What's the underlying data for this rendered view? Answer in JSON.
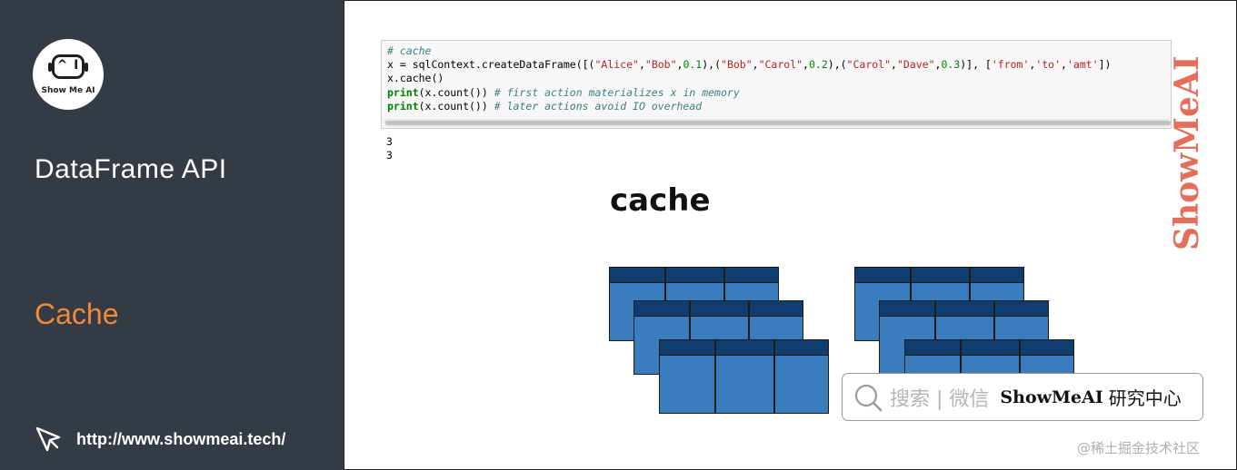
{
  "sidebar": {
    "logo_text": "Show Me AI",
    "logo_glyph": "^ I",
    "title": "DataFrame API",
    "section": "Cache",
    "link": "http://www.showmeai.tech/"
  },
  "code_cell": {
    "line1": "# cache",
    "line2": {
      "pre": "x = sqlContext.createDataFrame([(",
      "s1": "\"Alice\"",
      "c1": ",",
      "s2": "\"Bob\"",
      "c2": ",",
      "n1": "0.1",
      "c3": "),(",
      "s3": "\"Bob\"",
      "c4": ",",
      "s4": "\"Carol\"",
      "c5": ",",
      "n2": "0.2",
      "c6": "),(",
      "s5": "\"Carol\"",
      "c7": ",",
      "s6": "\"Dave\"",
      "c8": ",",
      "n3": "0.3",
      "c9": ")], [",
      "s7": "'from'",
      "c10": ",",
      "s8": "'to'",
      "c11": ",",
      "s9": "'amt'",
      "c12": "])"
    },
    "line3": "x.cache()",
    "line4": {
      "kw": "print",
      "code": "(x.count()) ",
      "comment": "# first action materializes x in memory"
    },
    "line5": {
      "kw": "print",
      "code": "(x.count()) ",
      "comment": "# later actions avoid IO overhead"
    }
  },
  "output": {
    "line1": "3",
    "line2": "3"
  },
  "diagram": {
    "title": "cache"
  },
  "watermark": "ShowMeAI",
  "search": {
    "hint": "搜索 | 微信",
    "brand": "ShowMeAI",
    "brand_cn": "研究中心"
  },
  "footer_credit": "@稀土掘金技术社区",
  "colors": {
    "sidebar_bg": "#343b45",
    "accent_orange": "#f08a3a",
    "table_body": "#3a7dbf",
    "table_header": "#0f3d6e",
    "watermark_red": "#e0533f"
  }
}
